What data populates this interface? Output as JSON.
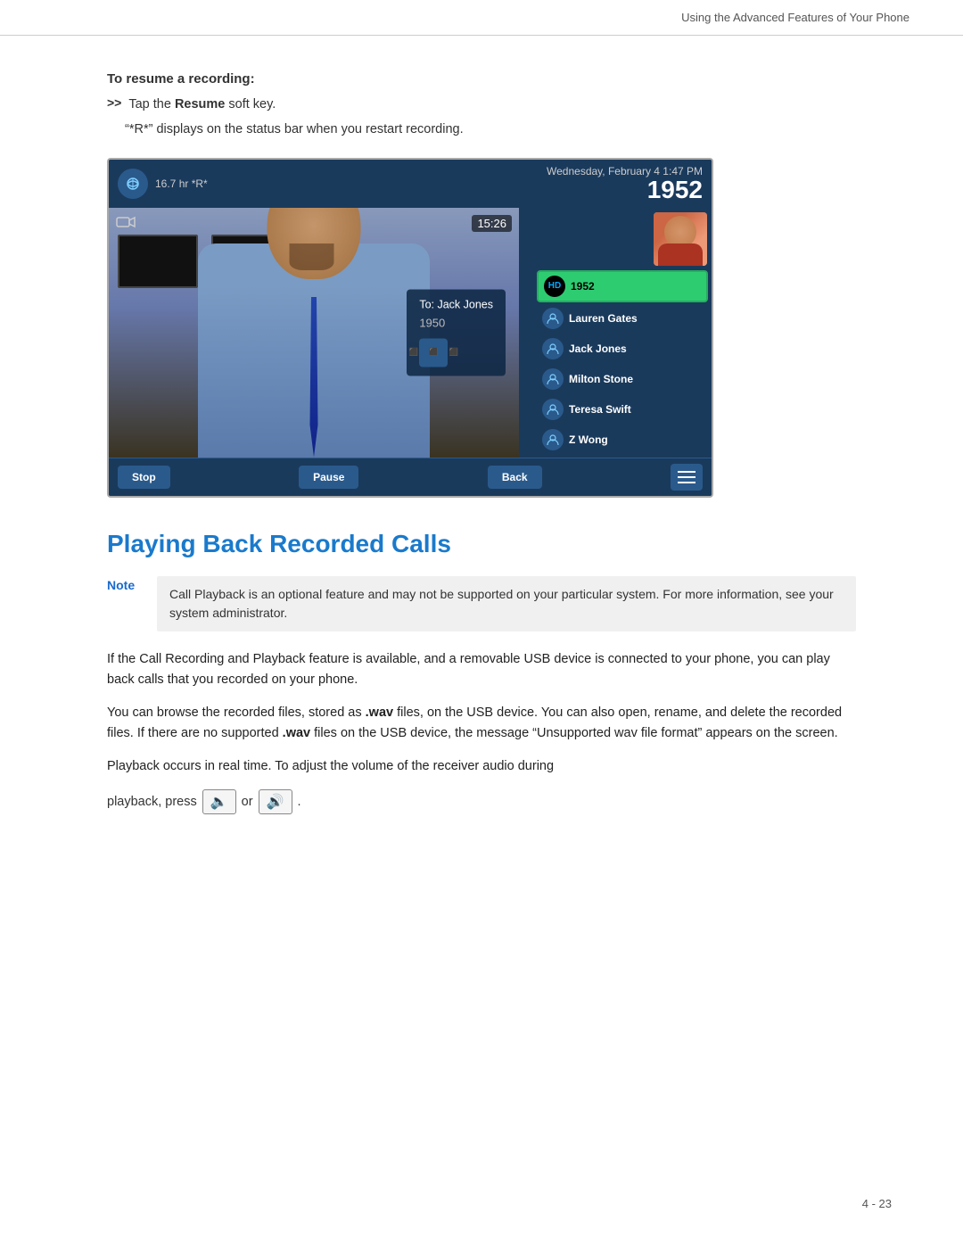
{
  "header": {
    "text": "Using the Advanced Features of Your Phone"
  },
  "resume_section": {
    "title": "To resume a recording:",
    "step_arrow": ">>",
    "step_text_prefix": "Tap the ",
    "step_bold": "Resume",
    "step_text_suffix": " soft key.",
    "status_note": "“*R*” displays on the status bar when you restart recording."
  },
  "phone_ui": {
    "recording_indicator": "16.7 hr *R*",
    "datetime": "Wednesday, February 4  1:47 PM",
    "number": "1952",
    "timer": "15:26",
    "call_to": "To: Jack Jones",
    "call_number": "1950",
    "contacts": [
      {
        "name": "1952",
        "active": true
      },
      {
        "name": "Lauren Gates",
        "active": false
      },
      {
        "name": "Jack Jones",
        "active": false
      },
      {
        "name": "Milton Stone",
        "active": false
      },
      {
        "name": "Teresa Swift",
        "active": false
      },
      {
        "name": "Z Wong",
        "active": false
      }
    ],
    "softkeys": [
      "Stop",
      "Pause",
      "Back"
    ]
  },
  "section_title": "Playing Back Recorded Calls",
  "note": {
    "label": "Note",
    "content": "Call Playback is an optional feature and may not be supported on your particular system. For more information, see your system administrator."
  },
  "paragraphs": [
    "If the Call Recording and Playback feature is available, and a removable USB device is connected to your phone, you can play back calls that you recorded on your phone.",
    "You can browse the recorded files, stored as .wav files, on the USB device. You can also open, rename, and delete the recorded files. If there are no supported .wav files on the USB device, the message “Unsupported wav file format” appears on the screen.",
    "Playback occurs in real time. To adjust the volume of the receiver audio during"
  ],
  "playback_line": {
    "prefix": "playback, press",
    "or": "or",
    "suffix": "."
  },
  "page_number": "4 - 23"
}
